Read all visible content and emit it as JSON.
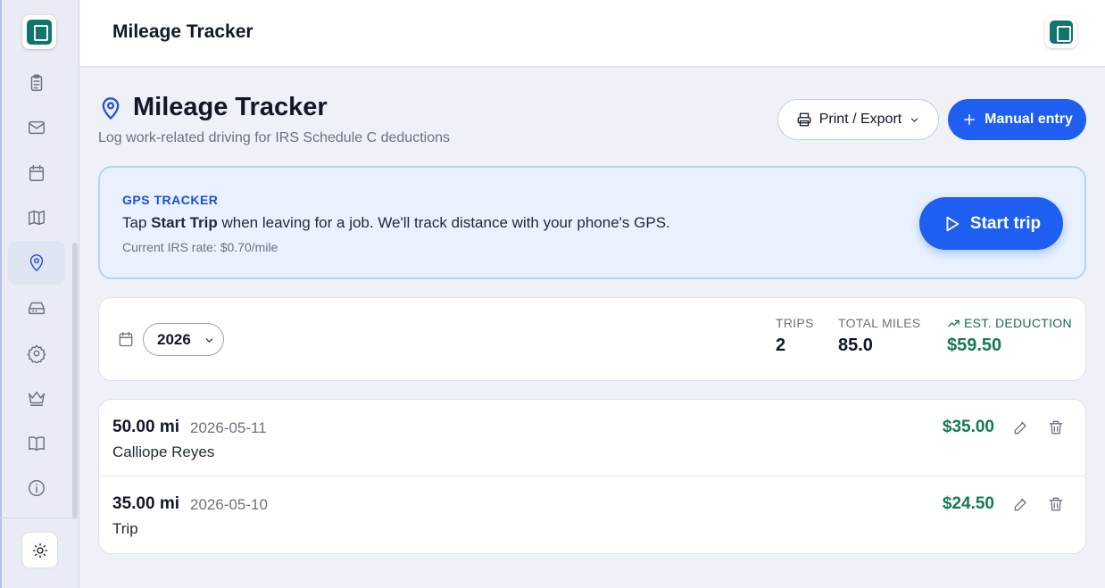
{
  "app": {
    "title": "Mileage Tracker"
  },
  "sidebar": {
    "items": [
      {
        "icon": "clipboard-icon",
        "active": false
      },
      {
        "icon": "mail-icon",
        "active": false
      },
      {
        "icon": "calendar-icon",
        "active": false
      },
      {
        "icon": "map-icon",
        "active": false
      },
      {
        "icon": "map-pin-icon",
        "active": true
      },
      {
        "icon": "inbox-icon",
        "active": false
      },
      {
        "icon": "gear-icon",
        "active": false
      },
      {
        "icon": "crown-icon",
        "active": false
      },
      {
        "icon": "book-icon",
        "active": false
      },
      {
        "icon": "info-icon",
        "active": false
      }
    ],
    "theme_toggle_icon": "sun-icon"
  },
  "header": {
    "title": "Mileage Tracker",
    "subtitle": "Log work-related driving for IRS Schedule C deductions",
    "export_label": "Print / Export",
    "manual_entry_label": "Manual entry"
  },
  "gps": {
    "label": "GPS TRACKER",
    "text_prefix": "Tap ",
    "text_bold": "Start Trip",
    "text_suffix": " when leaving for a job. We'll track distance with your phone's GPS.",
    "rate": "Current IRS rate: $0.70/mile",
    "start_label": "Start trip"
  },
  "stats": {
    "year": "2026",
    "trips_label": "TRIPS",
    "trips_value": "2",
    "miles_label": "TOTAL MILES",
    "miles_value": "85.0",
    "deduction_label": "EST. DEDUCTION",
    "deduction_value": "$59.50"
  },
  "trips": [
    {
      "miles": "50.00 mi",
      "date": "2026-05-11",
      "client": "Calliope Reyes",
      "amount": "$35.00"
    },
    {
      "miles": "35.00 mi",
      "date": "2026-05-10",
      "client": "Trip",
      "amount": "$24.50"
    }
  ],
  "colors": {
    "accent": "#1e5ef0",
    "deduction_green": "#157a52",
    "gps_bg": "#e8f1fd"
  }
}
